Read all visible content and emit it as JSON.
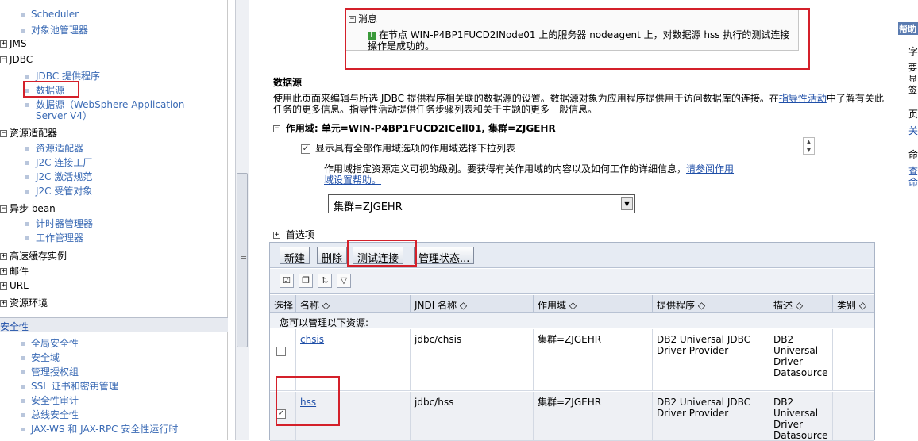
{
  "nav": {
    "items_top": [
      {
        "label": "Scheduler",
        "kind": "sub"
      },
      {
        "label": "对象池管理器",
        "kind": "sub"
      },
      {
        "label": "JMS",
        "kind": "top"
      },
      {
        "label": "JDBC",
        "kind": "top-open"
      },
      {
        "label": "JDBC 提供程序",
        "kind": "sub2"
      },
      {
        "label": "数据源",
        "kind": "sub2"
      },
      {
        "label": "数据源（WebSphere Application",
        "kind": "sub2"
      },
      {
        "label": "Server V4）",
        "kind": "cont"
      },
      {
        "label": "资源适配器",
        "kind": "top-open"
      },
      {
        "label": "资源适配器",
        "kind": "sub2"
      },
      {
        "label": "J2C 连接工厂",
        "kind": "sub2"
      },
      {
        "label": "J2C 激活规范",
        "kind": "sub2"
      },
      {
        "label": "J2C 受管对象",
        "kind": "sub2"
      },
      {
        "label": "异步 bean",
        "kind": "top-open"
      },
      {
        "label": "计时器管理器",
        "kind": "sub2"
      },
      {
        "label": "工作管理器",
        "kind": "sub2"
      },
      {
        "label": "高速缓存实例",
        "kind": "top"
      },
      {
        "label": "邮件",
        "kind": "top"
      },
      {
        "label": "URL",
        "kind": "top"
      },
      {
        "label": "资源环境",
        "kind": "top"
      }
    ],
    "security_header": "安全性",
    "security_items": [
      "全局安全性",
      "安全域",
      "管理授权组",
      "SSL 证书和密钥管理",
      "安全性审计",
      "总线安全性",
      "JAX-WS 和 JAX-RPC 安全性运行时"
    ]
  },
  "message": {
    "header": "消息",
    "text": "在节点 WIN-P4BP1FUCD2INode01 上的服务器 nodeagent 上，对数据源 hss 执行的测试连接操作是成功的。"
  },
  "page": {
    "title": "数据源",
    "desc_pre": "使用此页面来编辑与所选 JDBC 提供程序相关联的数据源的设置。数据源对象为应用程序提供用于访问数据库的连接。在",
    "desc_link": "指导性活动",
    "desc_post": "中了解有关此任务的更多信息。指导性活动提供任务步骤列表和关于主题的更多一般信息。",
    "scope_label": "作用域: 单元=WIN-P4BP1FUCD2ICell01, 集群=ZJGEHR",
    "show_scope_checkbox": "显示具有全部作用域选项的作用域选择下拉列表",
    "scope_help_pre": "作用域指定资源定义可视的级别。要获得有关作用域的内容以及如何工作的详细信息，",
    "scope_help_link": "请参阅作用域设置帮助。",
    "scope_select": "集群=ZJGEHR",
    "prefs": "首选项"
  },
  "buttons": {
    "new": "新建",
    "delete": "删除",
    "test": "测试连接",
    "status": "管理状态..."
  },
  "table": {
    "headers": [
      "选择",
      "名称 ◇",
      "JNDI 名称 ◇",
      "作用域 ◇",
      "提供程序 ◇",
      "描述 ◇",
      "类别 ◇"
    ],
    "manage_text": "您可以管理以下资源:",
    "rows": [
      {
        "checked": false,
        "name": "chsis",
        "jndi": "jdbc/chsis",
        "scope": "集群=ZJGEHR",
        "provider": "DB2 Universal JDBC Driver Provider",
        "desc": "DB2 Universal Driver Datasource"
      },
      {
        "checked": true,
        "name": "hss",
        "jndi": "jdbc/hss",
        "scope": "集群=ZJGEHR",
        "provider": "DB2 Universal JDBC Driver Provider",
        "desc": "DB2 Universal Driver Datasource"
      }
    ]
  },
  "help": {
    "header": "帮助",
    "lines": [
      "字",
      "要",
      "显",
      "签",
      "页",
      "关",
      "命",
      "查",
      "命"
    ]
  }
}
